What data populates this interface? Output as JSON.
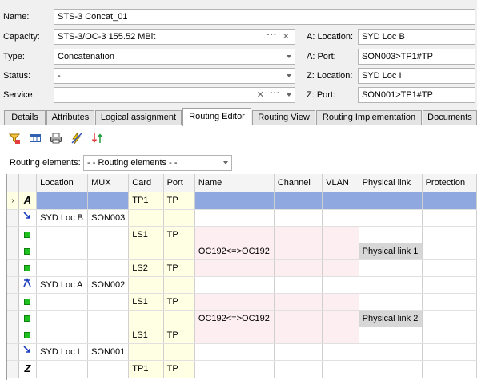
{
  "form": {
    "name_label": "Name:",
    "name_value": "STS-3 Concat_01",
    "capacity_label": "Capacity:",
    "capacity_value": "STS-3/OC-3 155.52 MBit",
    "type_label": "Type:",
    "type_value": "Concatenation",
    "status_label": "Status:",
    "status_value": "-",
    "service_label": "Service:",
    "service_value": "",
    "a_location_label": "A: Location:",
    "a_location_value": "SYD Loc B",
    "a_port_label": "A: Port:",
    "a_port_value": "SON003>TP1#TP",
    "z_location_label": "Z: Location:",
    "z_location_value": "SYD Loc I",
    "z_port_label": "Z: Port:",
    "z_port_value": "SON001>TP1#TP"
  },
  "tabs": [
    "Details",
    "Attributes",
    "Logical assignment",
    "Routing Editor",
    "Routing View",
    "Routing Implementation",
    "Documents"
  ],
  "active_tab": "Routing Editor",
  "toolbar_icons": [
    "filter-icon",
    "columns-icon",
    "print-icon",
    "lightning-icon",
    "sort-icon"
  ],
  "routing_elements": {
    "label": "Routing elements:",
    "selected": "- - Routing elements - -"
  },
  "grid": {
    "columns": [
      "Location",
      "MUX",
      "Card",
      "Port",
      "Name",
      "Channel",
      "VLAN",
      "Physical link",
      "Protection"
    ],
    "rows": [
      {
        "type": "A",
        "location": "",
        "mux": "",
        "card": "TP1",
        "port": "TP",
        "name": "",
        "channel": "",
        "vlan": "",
        "physical_link": "",
        "protection": ""
      },
      {
        "type": "mux-down",
        "location": "SYD Loc B",
        "mux": "SON003",
        "card": "",
        "port": "",
        "name": "",
        "channel": "",
        "vlan": "",
        "physical_link": "",
        "protection": ""
      },
      {
        "type": "port",
        "location": "",
        "mux": "",
        "card": "LS1",
        "port": "TP",
        "name": "",
        "channel": "",
        "vlan": "",
        "physical_link": "",
        "protection": ""
      },
      {
        "type": "port",
        "location": "",
        "mux": "",
        "card": "",
        "port": "",
        "name": "OC192<=>OC192",
        "channel": "",
        "vlan": "",
        "physical_link": "Physical link 1",
        "protection": ""
      },
      {
        "type": "port",
        "location": "",
        "mux": "",
        "card": "LS2",
        "port": "TP",
        "name": "",
        "channel": "",
        "vlan": "",
        "physical_link": "",
        "protection": ""
      },
      {
        "type": "mux-cross",
        "location": "SYD Loc A",
        "mux": "SON002",
        "card": "",
        "port": "",
        "name": "",
        "channel": "",
        "vlan": "",
        "physical_link": "",
        "protection": ""
      },
      {
        "type": "port",
        "location": "",
        "mux": "",
        "card": "LS1",
        "port": "TP",
        "name": "",
        "channel": "",
        "vlan": "",
        "physical_link": "",
        "protection": ""
      },
      {
        "type": "port",
        "location": "",
        "mux": "",
        "card": "",
        "port": "",
        "name": "OC192<=>OC192",
        "channel": "",
        "vlan": "",
        "physical_link": "Physical link 2",
        "protection": ""
      },
      {
        "type": "port",
        "location": "",
        "mux": "",
        "card": "LS1",
        "port": "TP",
        "name": "",
        "channel": "",
        "vlan": "",
        "physical_link": "",
        "protection": ""
      },
      {
        "type": "mux-down",
        "location": "SYD Loc I",
        "mux": "SON001",
        "card": "",
        "port": "",
        "name": "",
        "channel": "",
        "vlan": "",
        "physical_link": "",
        "protection": ""
      },
      {
        "type": "Z",
        "location": "",
        "mux": "",
        "card": "TP1",
        "port": "TP",
        "name": "",
        "channel": "",
        "vlan": "",
        "physical_link": "",
        "protection": ""
      }
    ]
  },
  "colors": {
    "selection": "#8fa8df",
    "yellow_cell": "#ffffe4",
    "pink_cell": "#fdeef2",
    "physical_link_cell": "#d7d7d7",
    "port_square": "#20c020",
    "mux_icon": "#1a3fbf"
  }
}
